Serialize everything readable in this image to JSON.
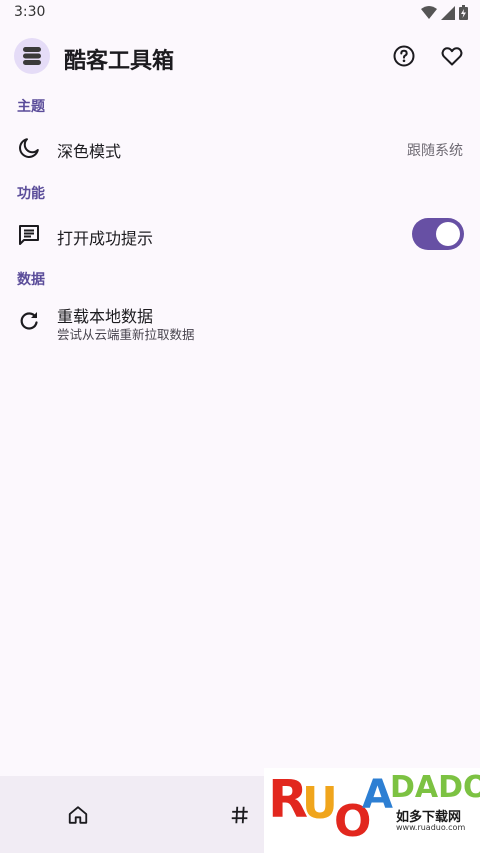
{
  "status": {
    "time": "3:30"
  },
  "app": {
    "title": "酷客工具箱"
  },
  "sections": {
    "theme": {
      "header": "主题",
      "dark_mode": {
        "title": "深色模式",
        "value": "跟随系统"
      }
    },
    "features": {
      "header": "功能",
      "success_tip": {
        "title": "打开成功提示",
        "enabled": true
      }
    },
    "data": {
      "header": "数据",
      "reload": {
        "title": "重载本地数据",
        "subtitle": "尝试从云端重新拉取数据"
      }
    }
  },
  "colors": {
    "accent": "#6750a4",
    "section_header": "#5b4d9a",
    "background": "#fcf8fd",
    "nav_background": "#f1ecf4"
  },
  "bottom_nav": {
    "items": [
      {
        "icon": "home-icon"
      },
      {
        "icon": "hashtag-icon"
      }
    ]
  },
  "watermark": {
    "brand": "RUANDUO",
    "caption": "如多下载网",
    "url": "www.ruaduo.com"
  }
}
